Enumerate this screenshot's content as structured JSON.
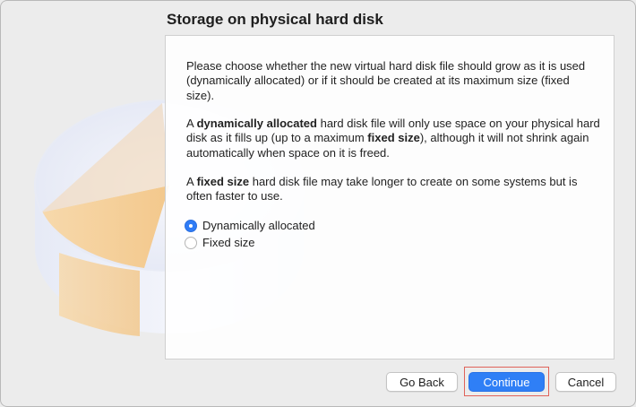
{
  "dialog": {
    "title": "Storage on physical hard disk"
  },
  "content": {
    "paragraph1": "Please choose whether the new virtual hard disk file should grow as it is used (dynamically allocated) or if it should be created at its maximum size (fixed size).",
    "paragraph2": {
      "part1": "A ",
      "bold1": "dynamically allocated",
      "part2": " hard disk file will only use space on your physical hard disk as it fills up (up to a maximum ",
      "bold2": "fixed size",
      "part3": "), although it will not shrink again automatically when space on it is freed."
    },
    "paragraph3": {
      "part1": "A ",
      "bold1": "fixed size",
      "part2": " hard disk file may take longer to create on some systems but is often faster to use."
    }
  },
  "options": [
    {
      "label": "Dynamically allocated",
      "selected": true
    },
    {
      "label": "Fixed size",
      "selected": false
    }
  ],
  "buttons": {
    "back": "Go Back",
    "continue": "Continue",
    "cancel": "Cancel"
  },
  "colors": {
    "accent": "#2f7ff6",
    "highlight": "#e0635a"
  },
  "icons": {
    "illustration": "hard-disk-pie-illustration"
  }
}
